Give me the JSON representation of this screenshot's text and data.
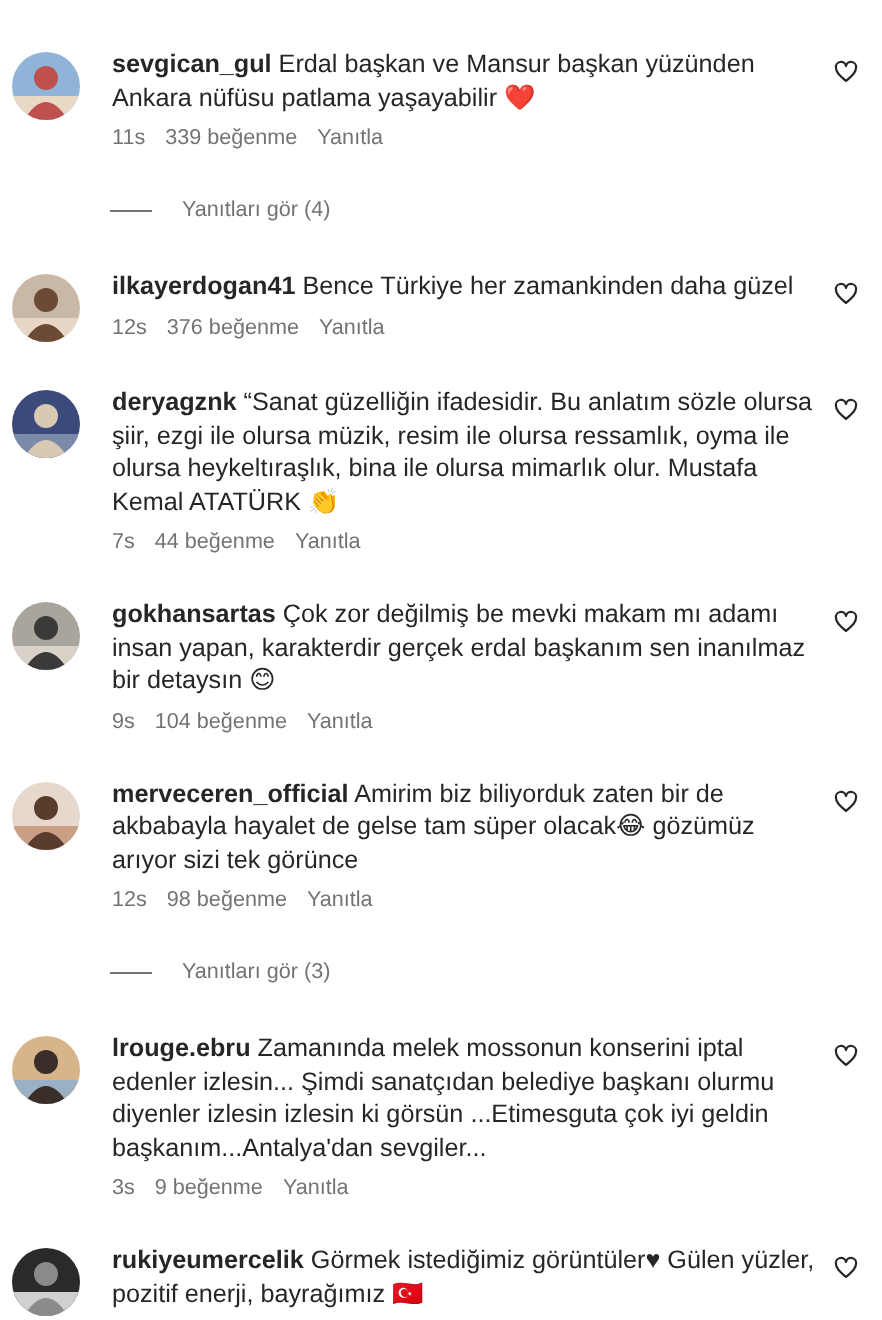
{
  "items": [
    {
      "kind": "comment",
      "username": "sevgican_gul",
      "text": "Erdal başkan ve Mansur başkan yüzünden Ankara nüfüsu patlama yaşayabilir ❤️",
      "time": "11s",
      "likes": "339 beğenme",
      "reply": "Yanıtla"
    },
    {
      "kind": "replies",
      "label": "Yanıtları gör (4)"
    },
    {
      "kind": "comment",
      "username": "ilkayerdogan41",
      "text": "Bence Türkiye her zamankinden daha güzel",
      "time": "12s",
      "likes": "376 beğenme",
      "reply": "Yanıtla"
    },
    {
      "kind": "comment",
      "username": "deryagznk",
      "text": "“Sanat güzelliğin ifadesidir. Bu anlatım sözle olursa şiir, ezgi ile olursa müzik, resim ile olursa ressamlık, oyma ile olursa heykeltıraşlık, bina ile olursa mimarlık olur. Mustafa Kemal ATATÜRK 👏",
      "time": "7s",
      "likes": "44 beğenme",
      "reply": "Yanıtla"
    },
    {
      "kind": "comment",
      "username": "gokhansartas",
      "text": "Çok zor değilmiş be mevki makam mı adamı insan yapan, karakterdir gerçek erdal başkanım sen inanılmaz bir detaysın 😊",
      "time": "9s",
      "likes": "104 beğenme",
      "reply": "Yanıtla"
    },
    {
      "kind": "comment",
      "username": "merveceren_official",
      "text": "Amirim biz biliyorduk zaten bir de akbabayla hayalet de gelse tam süper olacak😂 gözümüz arıyor sizi tek görünce",
      "time": "12s",
      "likes": "98 beğenme",
      "reply": "Yanıtla"
    },
    {
      "kind": "replies",
      "label": "Yanıtları gör (3)"
    },
    {
      "kind": "comment",
      "username": "lrouge.ebru",
      "text": "Zamanında melek mossonun konserini iptal edenler izlesin... Şimdi sanatçıdan belediye başkanı olurmu diyenler izlesin izlesin ki görsün ...Etimesguta çok iyi geldin başkanım...Antalya'dan sevgiler...",
      "time": "3s",
      "likes": "9 beğenme",
      "reply": "Yanıtla"
    },
    {
      "kind": "comment",
      "username": "rukiyeumercelik",
      "text": "Görmek istediğimiz görüntüler♥ Gülen yüzler, pozitif enerji, bayrağımız 🇹🇷"
    }
  ]
}
